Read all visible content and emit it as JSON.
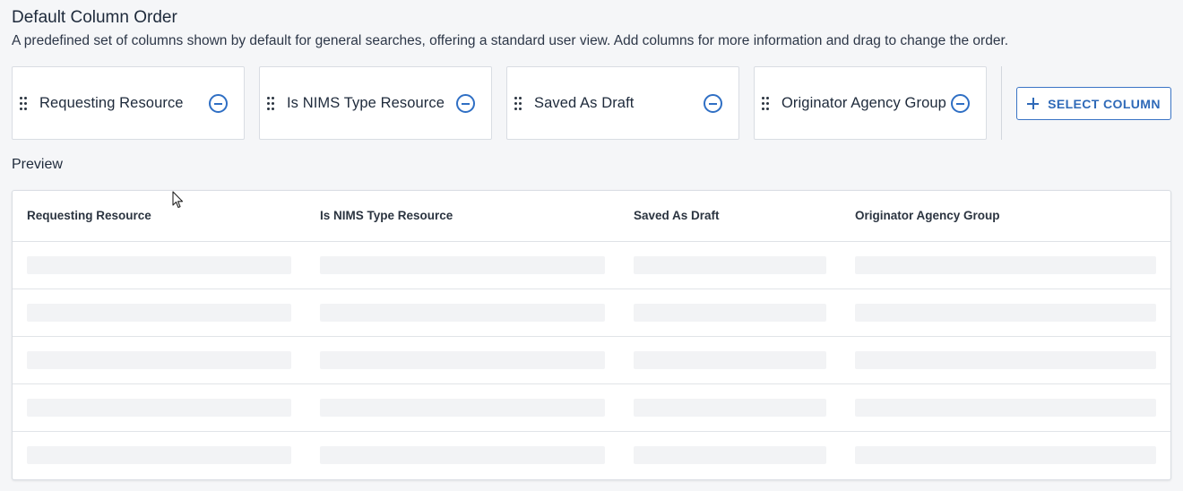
{
  "header": {
    "title": "Default Column Order",
    "description": "A predefined set of columns shown by default for general searches, offering a standard user view. Add columns for more information and drag to change the order."
  },
  "columns": [
    {
      "label": "Requesting Resource"
    },
    {
      "label": "Is NIMS Type Resource"
    },
    {
      "label": "Saved As Draft"
    },
    {
      "label": "Originator Agency Group"
    }
  ],
  "select_column_label": "SELECT COLUMN",
  "preview": {
    "label": "Preview",
    "headers": [
      "Requesting Resource",
      "Is NIMS Type Resource",
      "Saved As Draft",
      "Originator Agency Group"
    ],
    "skeleton_rows": 5
  },
  "colors": {
    "accent": "#2f6ab8",
    "skeleton": "#f2f3f5",
    "background": "#f5f6f8"
  },
  "icons": [
    "drag-handle-icon",
    "remove-circle-icon",
    "plus-icon",
    "mouse-cursor-icon"
  ]
}
